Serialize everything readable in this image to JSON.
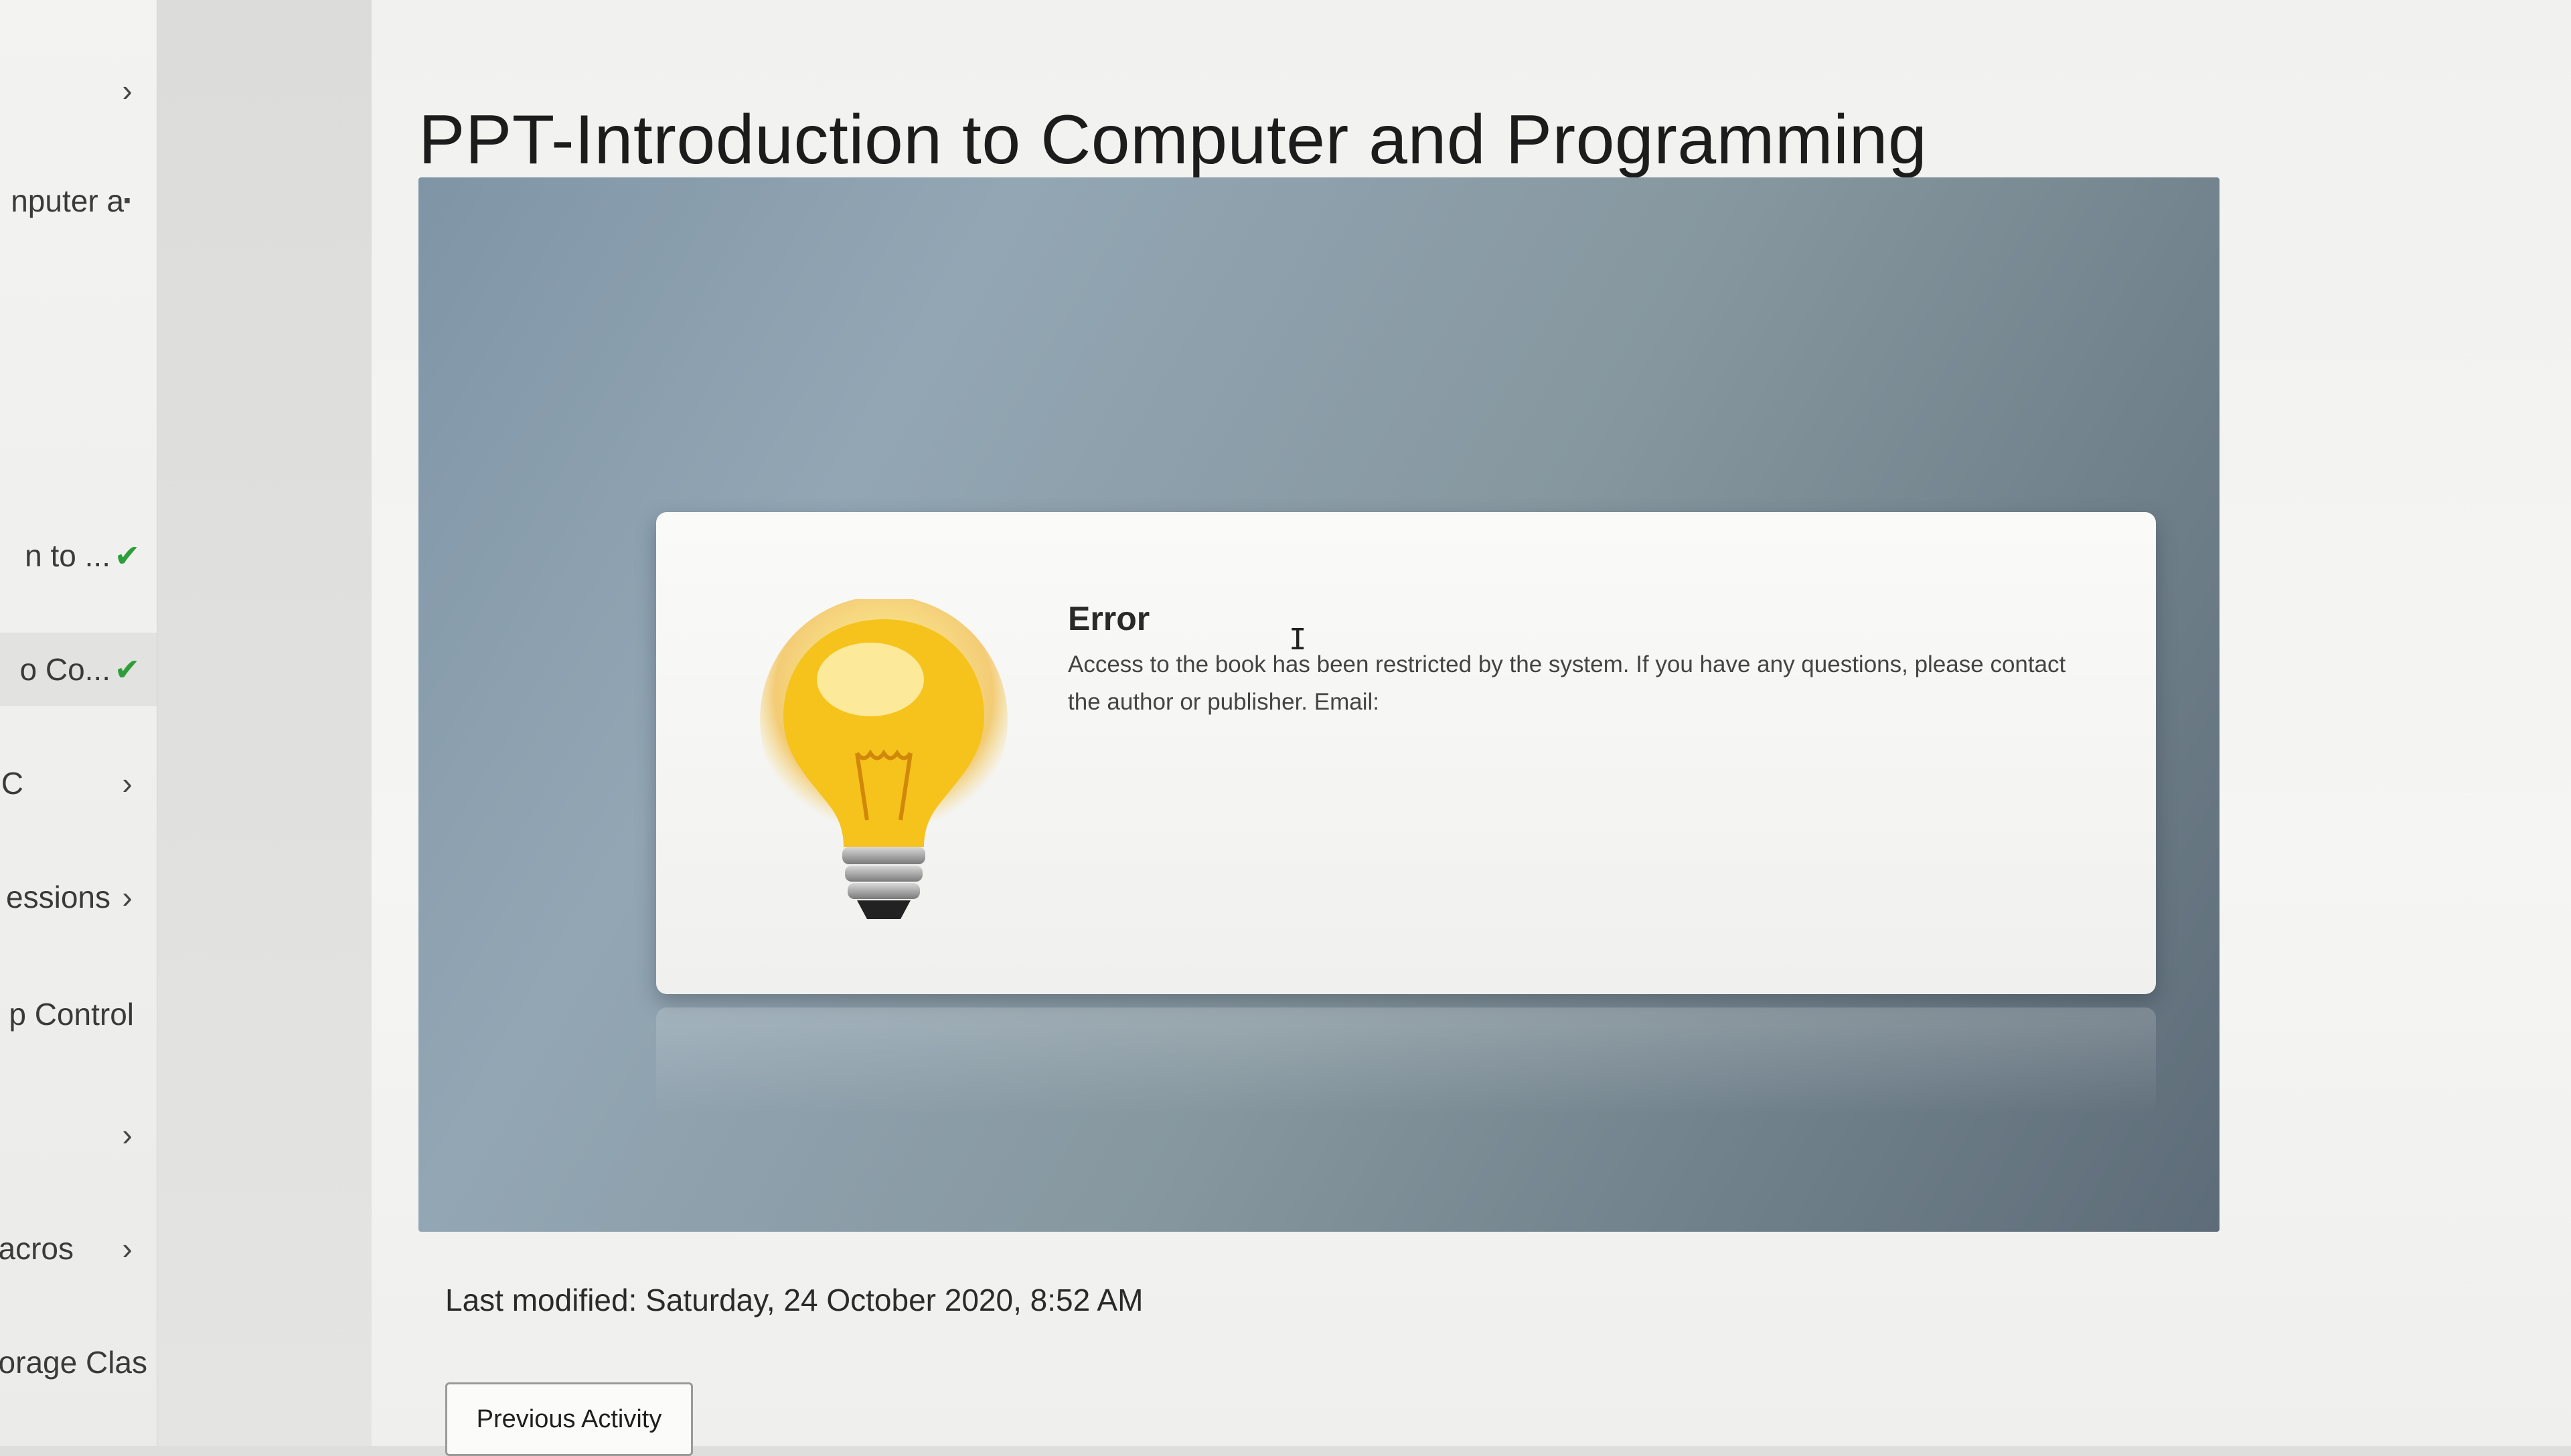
{
  "sidebar": {
    "items": [
      {
        "label": "",
        "mark": "›"
      },
      {
        "label": "nputer a",
        "mark": ""
      },
      {
        "label": "n to ...",
        "mark": "✔"
      },
      {
        "label": "o Co...",
        "mark": "✔"
      },
      {
        "label": "C",
        "mark": "›"
      },
      {
        "label": "essions",
        "mark": "›"
      },
      {
        "label": "p Control",
        "mark": ""
      },
      {
        "label": "",
        "mark": "›"
      },
      {
        "label": "acros",
        "mark": "›"
      },
      {
        "label": "orage Clas",
        "mark": ""
      }
    ]
  },
  "page": {
    "title": "PPT-Introduction to Computer and Programming"
  },
  "viewer": {
    "error_title": "Error",
    "error_message": "Access to the book has been restricted by the system. If you have any questions, please contact the author or publisher. Email:",
    "icon": "lightbulb-icon"
  },
  "footer": {
    "last_modified": "Last modified: Saturday, 24 October 2020, 8:52 AM",
    "previous_button": "Previous Activity"
  },
  "colors": {
    "check": "#2e9e3a",
    "viewer_bg": "#7f95a6",
    "bulb": "#f6c21c"
  }
}
